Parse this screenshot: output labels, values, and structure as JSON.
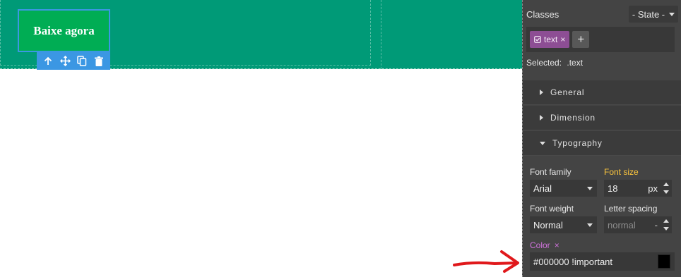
{
  "canvas": {
    "section_color": "#009a77",
    "button": {
      "label": "Baixe agora",
      "background": "#00ad54",
      "selection_color": "#3b97e3"
    },
    "toolbar_icons": [
      "arrow-up-icon",
      "move-icon",
      "copy-icon",
      "delete-icon"
    ]
  },
  "panel": {
    "classes_title": "Classes",
    "state_label": "- State -",
    "tags": [
      {
        "label": "text",
        "close": "×"
      }
    ],
    "add_tag": "+",
    "selected_label": "Selected:",
    "selected_value": ".text",
    "sectors": [
      {
        "label": "General",
        "open": false
      },
      {
        "label": "Dimension",
        "open": false
      },
      {
        "label": "Typography",
        "open": true
      }
    ],
    "typography": {
      "font_family": {
        "label": "Font family",
        "value": "Arial"
      },
      "font_size": {
        "label": "Font size",
        "value": "18",
        "unit": "px"
      },
      "font_weight": {
        "label": "Font weight",
        "value": "Normal"
      },
      "letter_spacing": {
        "label": "Letter spacing",
        "value": "normal",
        "unit": "-"
      },
      "color": {
        "label": "Color",
        "clear": "×",
        "value": "#000000 !important",
        "swatch": "#000000"
      }
    }
  },
  "annotation": {
    "arrow_color": "#e0181b"
  }
}
